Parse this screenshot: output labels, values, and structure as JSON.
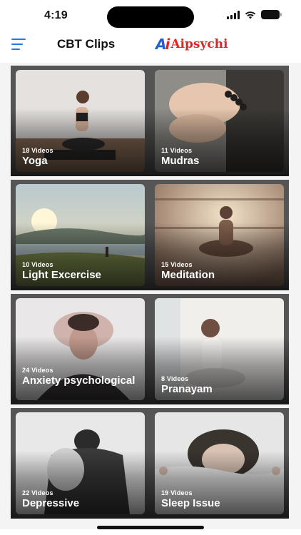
{
  "status_bar": {
    "time": "4:19"
  },
  "header": {
    "menu_icon": "hamburger-menu-icon",
    "title": "CBT Clips",
    "logo_text": "Aipsychi"
  },
  "categories": [
    {
      "count": "18 Videos",
      "name": "Yoga"
    },
    {
      "count": "11 Videos",
      "name": "Mudras"
    },
    {
      "count": "10 Videos",
      "name": "Light Excercise"
    },
    {
      "count": "15 Videos",
      "name": "Meditation"
    },
    {
      "count": "24 Videos",
      "name": "Anxiety psychological"
    },
    {
      "count": "8 Videos",
      "name": "Pranayam"
    },
    {
      "count": "22 Videos",
      "name": "Depressive"
    },
    {
      "count": "19 Videos",
      "name": "Sleep Issue"
    }
  ],
  "colors": {
    "accent": "#1e7be6",
    "logo_red": "#e02424",
    "logo_blue": "#1f5fd8"
  }
}
